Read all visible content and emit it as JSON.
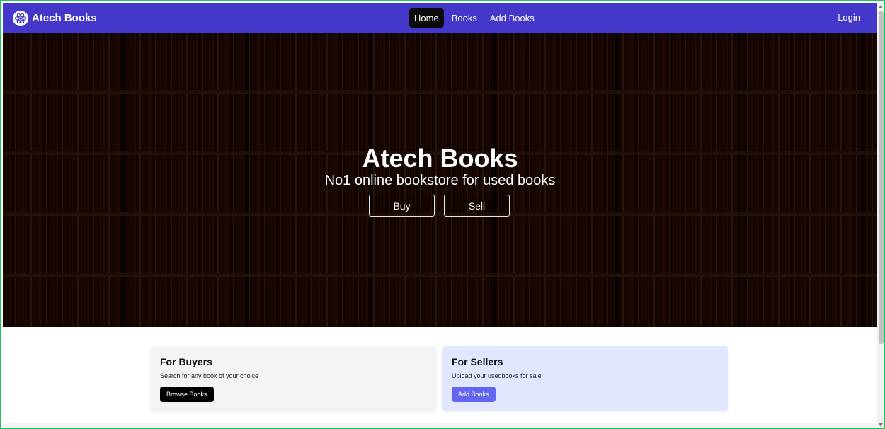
{
  "navbar": {
    "brand": "Atech Books",
    "brand_icon": "atom-logo-icon",
    "links": [
      "Home",
      "Books",
      "Add Books"
    ],
    "active_link": "Home",
    "login": "Login",
    "color": "#4338ca"
  },
  "hero": {
    "title": "Atech Books",
    "subtitle": "No1 online bookstore for used books",
    "buy_label": "Buy",
    "sell_label": "Sell"
  },
  "cards": {
    "buyers": {
      "title": "For Buyers",
      "text": "Search for any book of your choice",
      "button": "Browse Books"
    },
    "sellers": {
      "title": "For Sellers",
      "text": "Upload your usedbooks for sale",
      "button": "Add Books"
    }
  }
}
